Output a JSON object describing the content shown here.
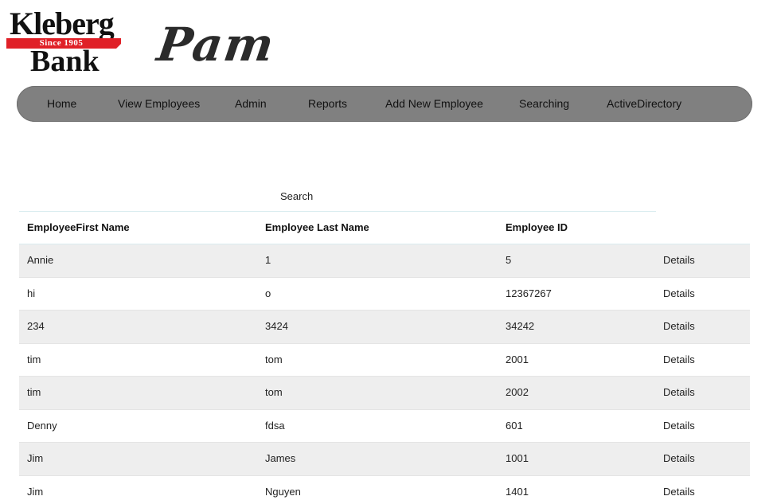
{
  "brand": {
    "bank_logo_top": "Kleberg",
    "bank_logo_band": "Since 1905",
    "bank_logo_bottom": "Bank",
    "app_logo": "Pam",
    "band_color": "#e02027"
  },
  "nav": {
    "bar_color": "#808080",
    "items": [
      {
        "label": "Home"
      },
      {
        "label": "View Employees"
      },
      {
        "label": "Admin"
      },
      {
        "label": "Reports"
      },
      {
        "label": "Add New Employee"
      },
      {
        "label": "Searching"
      },
      {
        "label": "ActiveDirectory"
      }
    ]
  },
  "table": {
    "search_label": "Search",
    "headers": [
      "EmployeeFirst Name",
      "Employee Last Name",
      "Employee ID"
    ],
    "rows": [
      {
        "first": "Annie",
        "last": "1",
        "id": "5",
        "action": "Details"
      },
      {
        "first": "hi",
        "last": "o",
        "id": "12367267",
        "action": "Details"
      },
      {
        "first": "234",
        "last": "3424",
        "id": "34242",
        "action": "Details"
      },
      {
        "first": "tim",
        "last": "tom",
        "id": "2001",
        "action": "Details"
      },
      {
        "first": "tim",
        "last": "tom",
        "id": "2002",
        "action": "Details"
      },
      {
        "first": "Denny",
        "last": "fdsa",
        "id": "601",
        "action": "Details"
      },
      {
        "first": "Jim",
        "last": "James",
        "id": "1001",
        "action": "Details"
      },
      {
        "first": "Jim",
        "last": "Nguyen",
        "id": "1401",
        "action": "Details"
      }
    ]
  }
}
